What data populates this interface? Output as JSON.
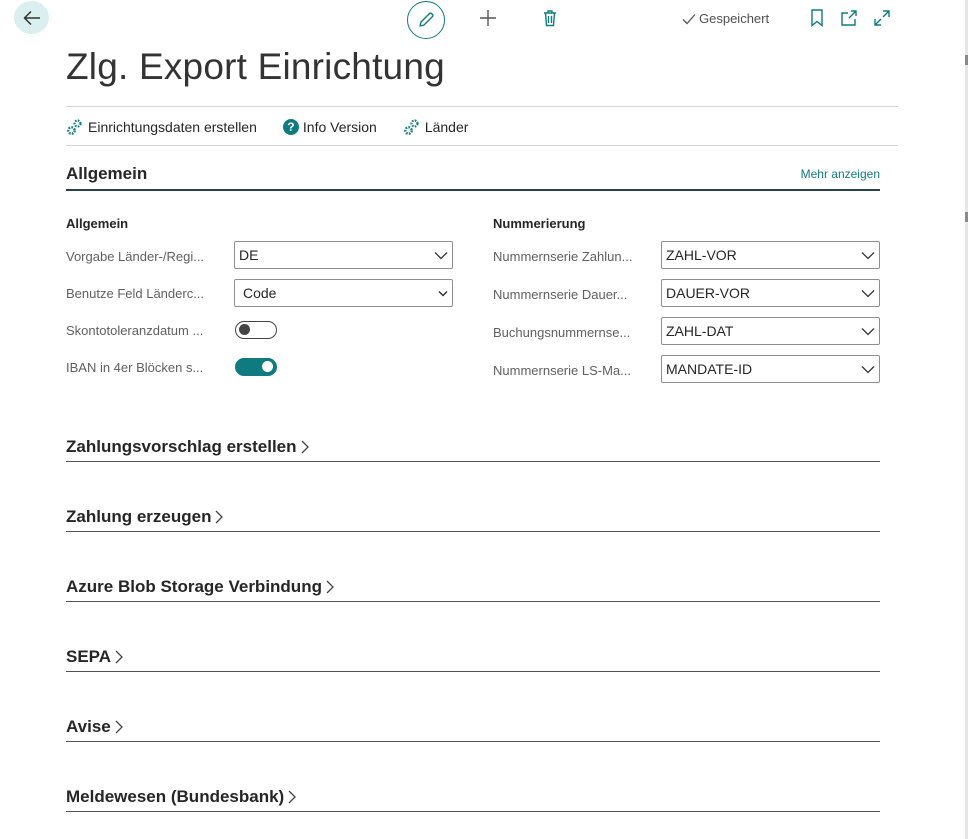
{
  "page": {
    "title": "Zlg. Export Einrichtung",
    "status_saved": "Gespeichert"
  },
  "icons": {
    "back": "arrow-left-icon",
    "edit": "pencil-icon",
    "new": "plus-icon",
    "delete": "trash-icon",
    "saved": "checkmark-icon",
    "bookmark": "bookmark-icon",
    "popout": "open-in-new-window-icon",
    "expand": "expand-icon"
  },
  "promoted_actions": [
    {
      "label": "Einrichtungsdaten erstellen",
      "icon": "gears-icon"
    },
    {
      "label": "Info Version",
      "icon": "question-icon"
    },
    {
      "label": "Länder",
      "icon": "gears-icon"
    }
  ],
  "general": {
    "title": "Allgemein",
    "show_more": "Mehr anzeigen",
    "left_group": {
      "label": "Allgemein",
      "fields": [
        {
          "label": "Vorgabe Länder-/Regi...",
          "type": "select",
          "value": "DE"
        },
        {
          "label": "Benutze Feld Länderc...",
          "type": "select",
          "value": "Code"
        },
        {
          "label": "Skontotoleranzdatum ...",
          "type": "toggle",
          "state": "off"
        },
        {
          "label": "IBAN in 4er Blöcken s...",
          "type": "toggle",
          "state": "on"
        }
      ]
    },
    "right_group": {
      "label": "Nummerierung",
      "fields": [
        {
          "label": "Nummernserie Zahlun...",
          "type": "select",
          "value": "ZAHL-VOR"
        },
        {
          "label": "Nummernserie Dauer...",
          "type": "select",
          "value": "DAUER-VOR"
        },
        {
          "label": "Buchungsnummernse...",
          "type": "select",
          "value": "ZAHL-DAT"
        },
        {
          "label": "Nummernserie LS-Ma...",
          "type": "select",
          "value": "MANDATE-ID"
        }
      ]
    }
  },
  "collapsed_sections": [
    {
      "title": "Zahlungsvorschlag erstellen"
    },
    {
      "title": "Zahlung erzeugen"
    },
    {
      "title": "Azure Blob Storage Verbindung"
    },
    {
      "title": "SEPA"
    },
    {
      "title": "Avise"
    },
    {
      "title": "Meldewesen (Bundesbank)"
    }
  ],
  "colors": {
    "accent": "#0f7b80",
    "back_button_bg": "#dbeff0",
    "text": "#212121",
    "muted_label": "#606060"
  }
}
